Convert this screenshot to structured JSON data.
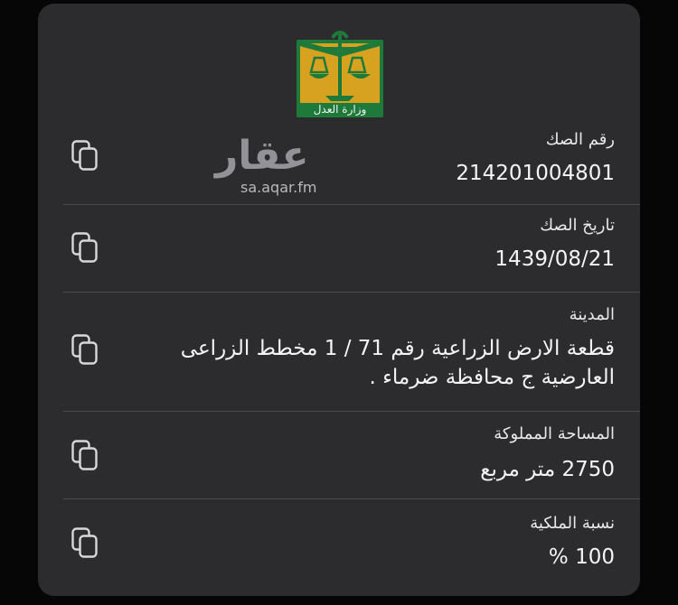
{
  "ministry_logo": {
    "icon": "ministry-of-justice-emblem-icon",
    "text": "وزارة العدل"
  },
  "watermark": {
    "arabic": "عقار",
    "site": "sa.aqar.fm"
  },
  "fields": [
    {
      "label": "رقم الصك",
      "value": "214201004801"
    },
    {
      "label": "تاريخ الصك",
      "value": "1439/08/21"
    },
    {
      "label": "المدينة",
      "value": "قطعة الارض الزراعية  رقم 71 / 1 مخطط الزراعى العارضية ج  محافظة ضرماء ."
    },
    {
      "label": "المساحة المملوكة",
      "value": "2750 متر مربع"
    },
    {
      "label": "نسبة الملكية",
      "value": "100 %"
    }
  ],
  "copy_icon": "copy-icon",
  "colors": {
    "card": "#2c2c2e",
    "background": "#060606",
    "logo_green": "#1e7a3a",
    "logo_gold": "#d7a21f"
  }
}
